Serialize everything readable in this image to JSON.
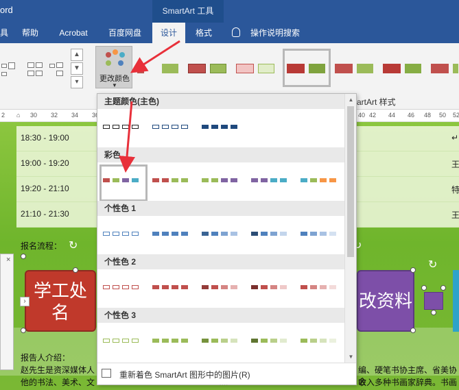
{
  "window": {
    "app_title": "ord",
    "context_tab": "SmartArt 工具"
  },
  "tabs": [
    {
      "label": "具"
    },
    {
      "label": "帮助"
    },
    {
      "label": "Acrobat"
    },
    {
      "label": "百度网盘"
    },
    {
      "label": "设计"
    },
    {
      "label": "格式"
    },
    {
      "label": "操作说明搜索"
    }
  ],
  "ribbon": {
    "change_colors_label": "更改颜色",
    "styles_group_label": "artArt 样式"
  },
  "ruler_ticks": [
    "2",
    "30",
    "32",
    "34",
    "36",
    "38",
    "40",
    "42",
    "44",
    "46",
    "48",
    "50",
    "52"
  ],
  "document": {
    "schedule": [
      {
        "time": "18:30 - 19:00",
        "right": "↵"
      },
      {
        "time": "19:00 - 19:20",
        "right": "王"
      },
      {
        "time": "19:20 - 21:10",
        "right": "特"
      },
      {
        "time": "21:10 - 21:30",
        "right": "王"
      }
    ],
    "signup_label": "报名流程：",
    "shape_left_text": "学工处名",
    "shape_right_text": "改资料",
    "reporter_label": "报告人介绍：",
    "para_line1_left": "赵先生是资深媒体人",
    "para_line1_right": "编、硬笔书协主席、省美协会",
    "para_line2_left": "他的书法、美术、文",
    "para_line2_right": "收入多种书画家辞典。书画作"
  },
  "dropdown": {
    "sections": [
      {
        "header": "主题颜色(主色)"
      },
      {
        "header": "彩色"
      },
      {
        "header": "个性色 1"
      },
      {
        "header": "个性色 2"
      },
      {
        "header": "个性色 3"
      }
    ],
    "footer_label": "重新着色 SmartArt 图形中的图片(R)"
  },
  "colors": {
    "ribbon_blue": "#2b579a",
    "accent_red": "#c0504d",
    "accent_green": "#9bbb59",
    "accent_blue": "#4f81bd",
    "accent_purple": "#8064a2",
    "accent_teal": "#4bacc6",
    "accent_orange": "#f79646",
    "annotation_arrow": "#e8303a"
  }
}
